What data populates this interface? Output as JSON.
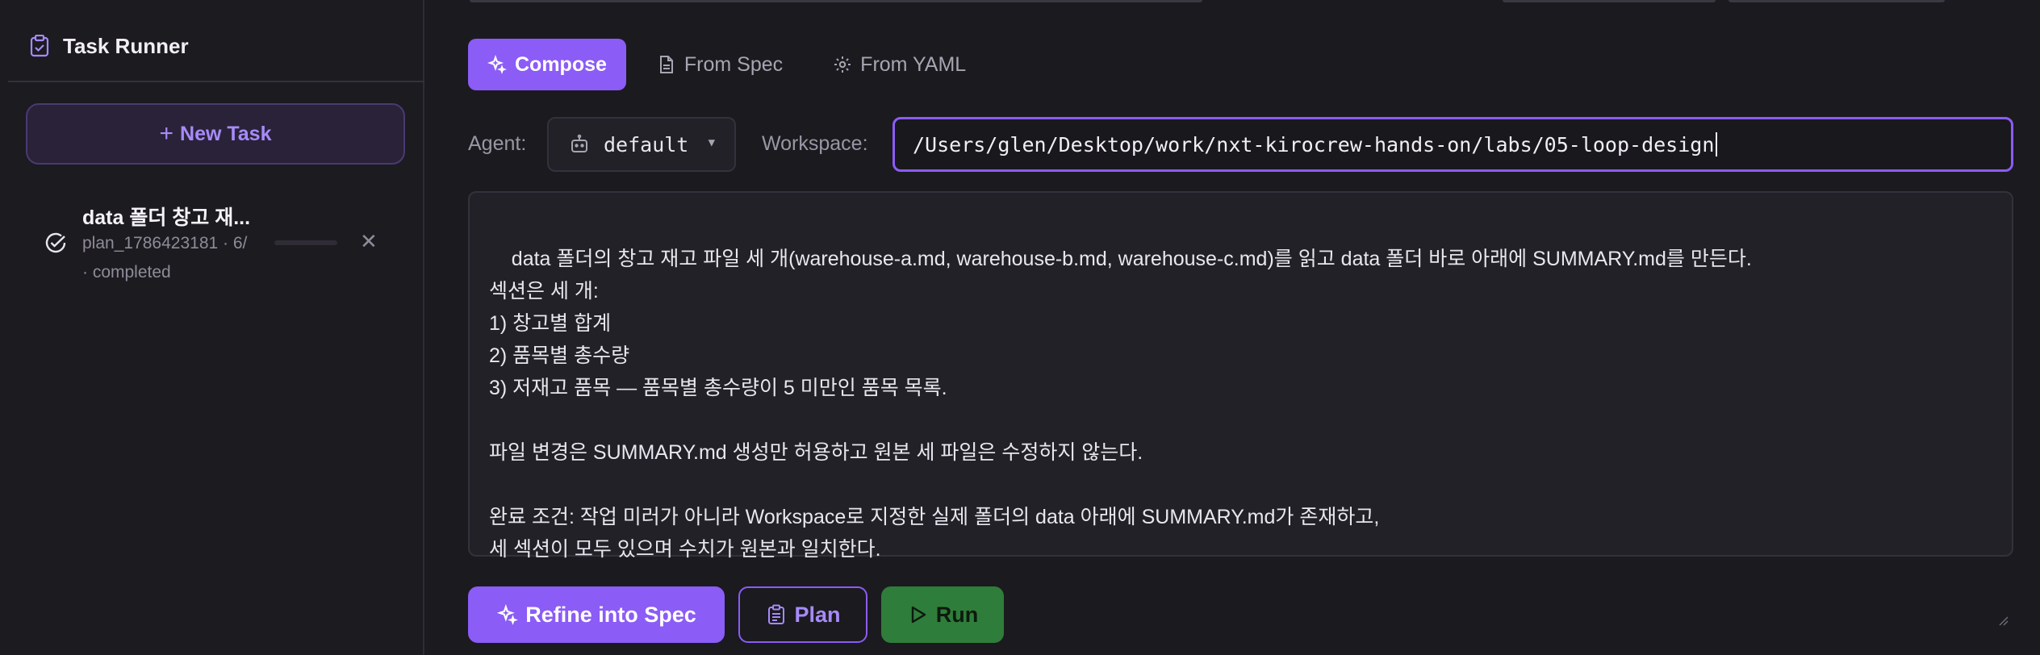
{
  "sidebar": {
    "title": "Task Runner",
    "new_task_label": "New Task",
    "tasks": [
      {
        "title": "data 폴더 창고 재...",
        "meta": "plan_1786423181 · 6/",
        "status": "· completed",
        "progress": 0
      }
    ]
  },
  "tabs": [
    {
      "label": "Compose",
      "icon": "sparkles-icon",
      "active": true
    },
    {
      "label": "From Spec",
      "icon": "document-icon",
      "active": false
    },
    {
      "label": "From YAML",
      "icon": "gear-icon",
      "active": false
    }
  ],
  "agent": {
    "label": "Agent:",
    "value": "default",
    "icon": "bot-icon"
  },
  "workspace": {
    "label": "Workspace:",
    "value": "/Users/glen/Desktop/work/nxt-kirocrew-hands-on/labs/05-loop-design"
  },
  "task_text": "data 폴더의 창고 재고 파일 세 개(warehouse-a.md, warehouse-b.md, warehouse-c.md)를 읽고 data 폴더 바로 아래에 SUMMARY.md를 만든다.\n섹션은 세 개:\n1) 창고별 합계\n2) 품목별 총수량\n3) 저재고 품목 — 품목별 총수량이 5 미만인 품목 목록.\n\n파일 변경은 SUMMARY.md 생성만 허용하고 원본 세 파일은 수정하지 않는다.\n\n완료 조건: 작업 미러가 아니라 Workspace로 지정한 실제 폴더의 data 아래에 SUMMARY.md가 존재하고,\n세 섹션이 모두 있으며 수치가 원본과 일치한다.",
  "actions": {
    "refine_label": "Refine into Spec",
    "plan_label": "Plan",
    "run_label": "Run"
  },
  "colors": {
    "accent": "#8b5cf6",
    "accent_text": "#a78bfa",
    "run": "#2f7d3a",
    "background": "#1b1a1f"
  }
}
